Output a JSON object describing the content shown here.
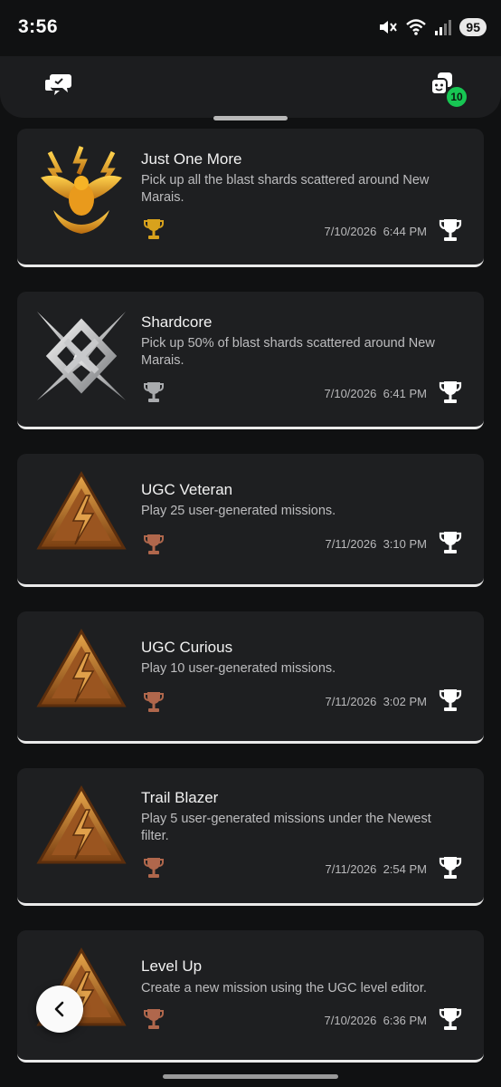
{
  "status_bar": {
    "time": "3:56",
    "battery": "95",
    "icons": [
      "mute-icon",
      "wifi-icon",
      "signal-icon"
    ]
  },
  "header": {
    "left_icon": "chat-bubbles-icon",
    "right_icon": "friends-icon",
    "notification_count": "10"
  },
  "trophies": [
    {
      "title": "Just One More",
      "description": "Pick up all the blast shards scattered around New Marais.",
      "date": "7/10/2026",
      "time": "6:44 PM",
      "grade": "gold",
      "art": "gold-eagle-emblem"
    },
    {
      "title": "Shardcore",
      "description": "Pick up 50% of blast shards scattered around New Marais.",
      "date": "7/10/2026",
      "time": "6:41 PM",
      "grade": "silver",
      "art": "silver-shard-emblem"
    },
    {
      "title": "UGC Veteran",
      "description": "Play 25 user-generated missions.",
      "date": "7/11/2026",
      "time": "3:10 PM",
      "grade": "bronze",
      "art": "bronze-lightning-triangle"
    },
    {
      "title": "UGC Curious",
      "description": "Play 10 user-generated missions.",
      "date": "7/11/2026",
      "time": "3:02 PM",
      "grade": "bronze",
      "art": "bronze-lightning-triangle"
    },
    {
      "title": "Trail Blazer",
      "description": "Play 5 user-generated missions under the Newest filter.",
      "date": "7/11/2026",
      "time": "2:54 PM",
      "grade": "bronze",
      "art": "bronze-lightning-triangle"
    },
    {
      "title": "Level Up",
      "description": "Create a new mission using the UGC level editor.",
      "date": "7/10/2026",
      "time": "6:36 PM",
      "grade": "bronze",
      "art": "bronze-lightning-triangle"
    }
  ],
  "colors": {
    "background": "#101112",
    "card": "#1e1f21",
    "gold": "#d8a21c",
    "silver": "#a9abae",
    "bronze": "#b0674c",
    "badge": "#17c653"
  },
  "controls": {
    "back_icon": "chevron-left-icon"
  }
}
